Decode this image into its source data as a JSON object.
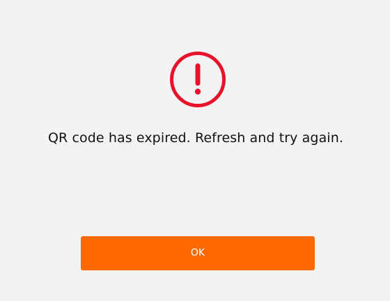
{
  "dialog": {
    "icon": "exclamation-circle-icon",
    "message": "QR code has expired. Refresh and try again.",
    "ok_label": "OK"
  },
  "colors": {
    "background": "#f3f3f3",
    "alert": "#e8132a",
    "button": "#ff6a00",
    "button_text": "#ffffff",
    "message_text": "#111111"
  }
}
